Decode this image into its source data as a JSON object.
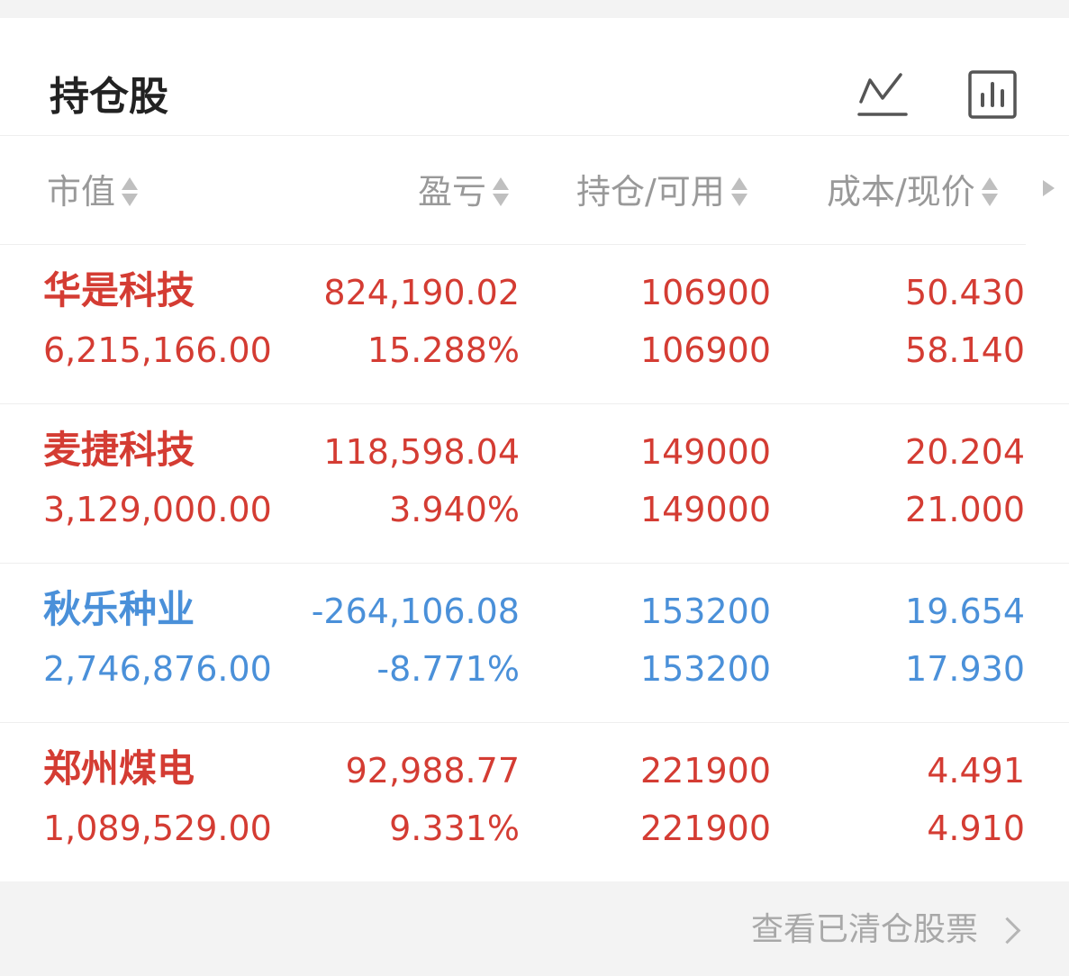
{
  "header": {
    "title": "持仓股",
    "icons": [
      "line-chart-icon",
      "bar-chart-icon"
    ]
  },
  "columns": {
    "market_value": "市值",
    "profit_loss": "盈亏",
    "position": "持仓/可用",
    "cost_price": "成本/现价"
  },
  "holdings": [
    {
      "name": "华是科技",
      "market_value": "6,215,166.00",
      "profit": "824,190.02",
      "profit_pct": "15.288%",
      "position": "106900",
      "available": "106900",
      "cost": "50.430",
      "price": "58.140",
      "trend": "up"
    },
    {
      "name": "麦捷科技",
      "market_value": "3,129,000.00",
      "profit": "118,598.04",
      "profit_pct": "3.940%",
      "position": "149000",
      "available": "149000",
      "cost": "20.204",
      "price": "21.000",
      "trend": "up"
    },
    {
      "name": "秋乐种业",
      "market_value": "2,746,876.00",
      "profit": "-264,106.08",
      "profit_pct": "-8.771%",
      "position": "153200",
      "available": "153200",
      "cost": "19.654",
      "price": "17.930",
      "trend": "down"
    },
    {
      "name": "郑州煤电",
      "market_value": "1,089,529.00",
      "profit": "92,988.77",
      "profit_pct": "9.331%",
      "position": "221900",
      "available": "221900",
      "cost": "4.491",
      "price": "4.910",
      "trend": "up"
    }
  ],
  "footer": {
    "link_label": "查看已清仓股票"
  },
  "colors": {
    "up": "#d43c33",
    "down": "#4a90d9"
  }
}
